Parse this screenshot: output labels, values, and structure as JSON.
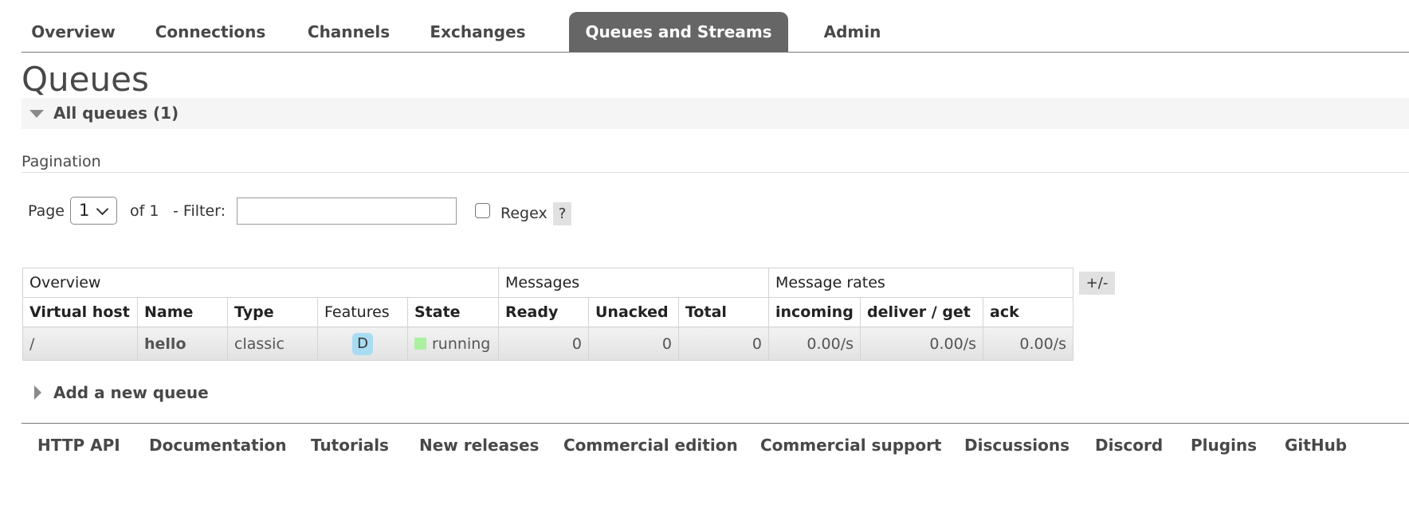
{
  "nav": {
    "items": [
      {
        "label": "Overview"
      },
      {
        "label": "Connections"
      },
      {
        "label": "Channels"
      },
      {
        "label": "Exchanges"
      },
      {
        "label": "Queues and Streams",
        "active": true
      },
      {
        "label": "Admin"
      }
    ]
  },
  "page": {
    "title": "Queues"
  },
  "all_queues": {
    "label": "All queues (1)"
  },
  "pagination": {
    "title": "Pagination",
    "page_label": "Page",
    "page_value": "1",
    "of_label": "of 1",
    "filter_label": "- Filter:",
    "filter_value": "",
    "regex_label": "Regex",
    "regex_checked": false,
    "help_label": "?"
  },
  "table": {
    "groups": [
      "Overview",
      "Messages",
      "Message rates"
    ],
    "columns": [
      "Virtual host",
      "Name",
      "Type",
      "Features",
      "State",
      "Ready",
      "Unacked",
      "Total",
      "incoming",
      "deliver / get",
      "ack"
    ],
    "rows": [
      {
        "vhost": "/",
        "name": "hello",
        "type": "classic",
        "features": "D",
        "state": "running",
        "ready": "0",
        "unacked": "0",
        "total": "0",
        "incoming": "0.00/s",
        "deliver_get": "0.00/s",
        "ack": "0.00/s"
      }
    ],
    "toggle_label": "+/-"
  },
  "add_queue": {
    "label": "Add a new queue"
  },
  "footer": {
    "links": [
      "HTTP API",
      "Documentation",
      "Tutorials",
      "New releases",
      "Commercial edition",
      "Commercial support",
      "Discussions",
      "Discord",
      "Plugins",
      "GitHub"
    ]
  },
  "colors": {
    "nav_active_bg": "#666666",
    "state_running": "#aaf0a0",
    "feature_badge": "#a8dcf2"
  }
}
